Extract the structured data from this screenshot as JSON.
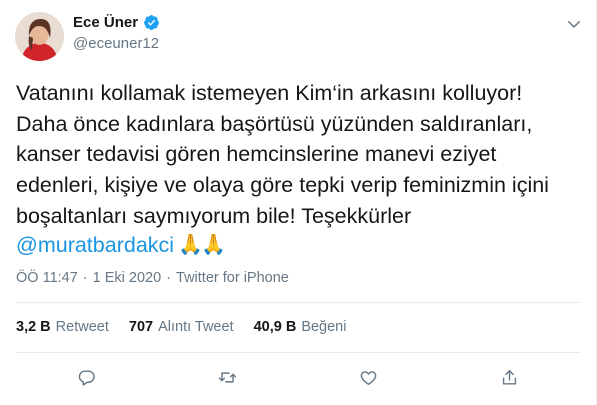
{
  "author": {
    "display_name": "Ece Üner",
    "handle": "@eceuner12",
    "verified_icon": "verified-badge-icon"
  },
  "tweet": {
    "text": "Vatanını kollamak istemeyen Kim‘in arkasını kolluyor!\nDaha önce kadınlara başörtüsü yüzünden saldıranları,\nkanser tedavisi gören hemcinslerine manevi eziyet\nedenleri, kişiye ve olaya göre tepki verip feminizmin içini\nboşaltanları saymıyorum bile! Teşekkürler",
    "mention": "@muratbardakci",
    "emoji": "🙏🙏"
  },
  "meta": {
    "time": "ÖÖ 11:47",
    "separator1": "·",
    "date": "1 Eki 2020",
    "separator2": "·",
    "source": "Twitter for iPhone"
  },
  "stats": {
    "retweets_count": "3,2 B",
    "retweets_label": "Retweet",
    "quotes_count": "707",
    "quotes_label": "Alıntı Tweet",
    "likes_count": "40,9 B",
    "likes_label": "Beğeni"
  },
  "colors": {
    "link": "#1b95e0",
    "muted": "#657786",
    "text": "#14171a",
    "divider": "#e6ecf0"
  },
  "icons": {
    "reply": "reply-icon",
    "retweet": "retweet-icon",
    "like": "heart-icon",
    "share": "share-icon",
    "more": "chevron-down-icon"
  }
}
